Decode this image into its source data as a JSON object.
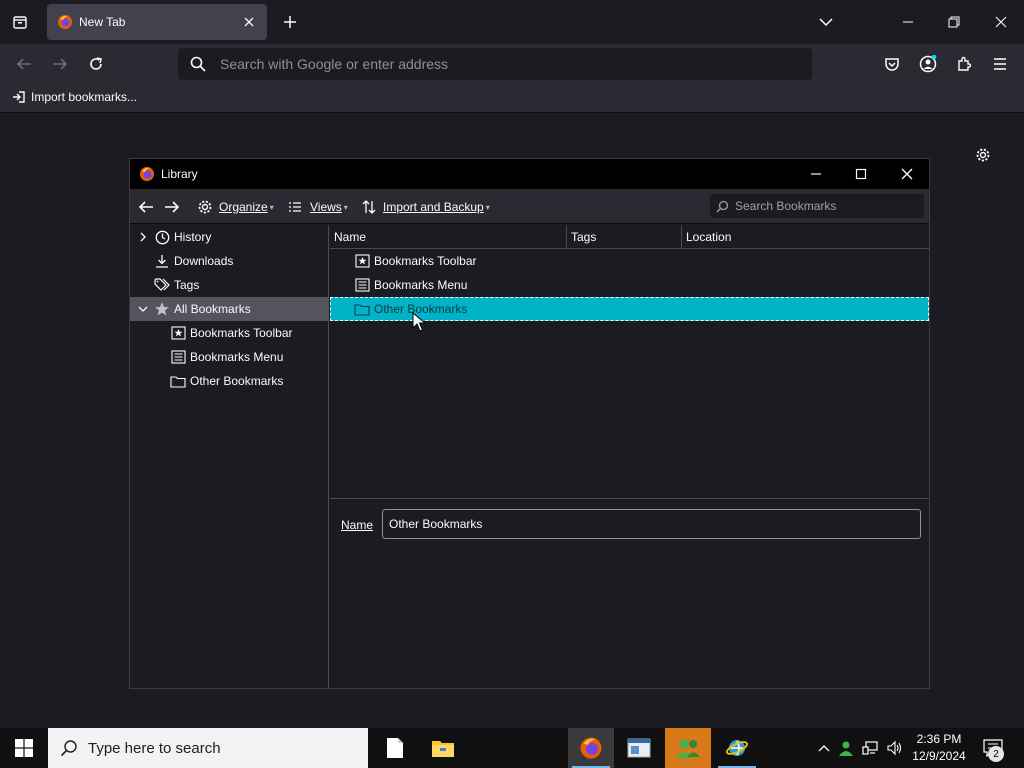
{
  "browser": {
    "tab_title": "New Tab",
    "url_placeholder": "Search with Google or enter address",
    "bookmarks_bar_item": "Import bookmarks..."
  },
  "library": {
    "window_title": "Library",
    "toolbar": {
      "organize": "Organize",
      "views": "Views",
      "import_backup": "Import and Backup",
      "search_placeholder": "Search Bookmarks"
    },
    "tree": [
      {
        "label": "History",
        "icon": "clock-icon"
      },
      {
        "label": "Downloads",
        "icon": "download-icon"
      },
      {
        "label": "Tags",
        "icon": "tag-icon"
      },
      {
        "label": "All Bookmarks",
        "icon": "star-icon",
        "selected": true
      },
      {
        "label": "Bookmarks Toolbar",
        "icon": "bookmarks-toolbar-icon"
      },
      {
        "label": "Bookmarks Menu",
        "icon": "bookmarks-menu-icon"
      },
      {
        "label": "Other Bookmarks",
        "icon": "folder-icon"
      }
    ],
    "columns": [
      "Name",
      "Tags",
      "Location"
    ],
    "rows": [
      {
        "name": "Bookmarks Toolbar",
        "icon": "bookmarks-toolbar-icon"
      },
      {
        "name": "Bookmarks Menu",
        "icon": "bookmarks-menu-icon"
      },
      {
        "name": "Other Bookmarks",
        "icon": "folder-icon",
        "selected": true
      }
    ],
    "detail": {
      "name_label": "Name",
      "name_value": "Other Bookmarks"
    }
  },
  "taskbar": {
    "search_placeholder": "Type here to search",
    "time": "2:36 PM",
    "date": "12/9/2024",
    "notification_count": "2"
  },
  "colors": {
    "selection": "#00b3c7",
    "chrome": "#2b2a33",
    "background": "#1c1b22"
  }
}
